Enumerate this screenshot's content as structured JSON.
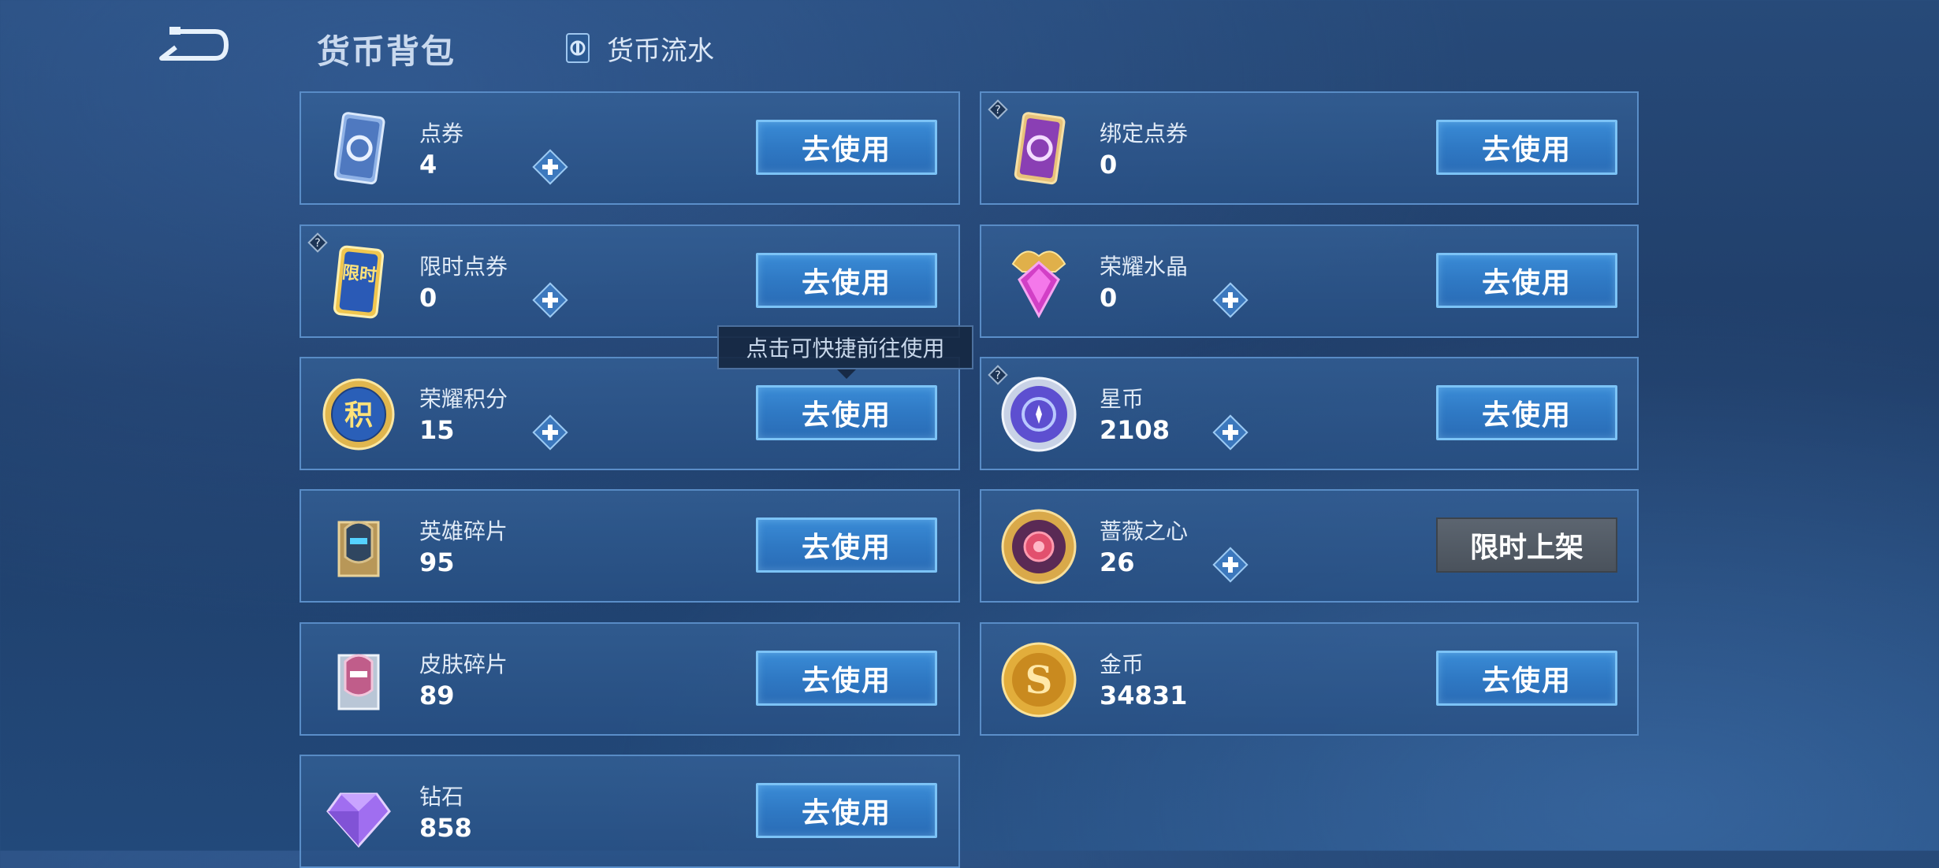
{
  "header": {
    "title": "货币背包",
    "flow_tab": "货币流水"
  },
  "tooltip": "点击可快捷前往使用",
  "currencies": [
    {
      "name": "点券",
      "value": "4",
      "button": "去使用",
      "icon": "ticket-icon"
    },
    {
      "name": "绑定点券",
      "value": "0",
      "button": "去使用",
      "icon": "bound-ticket-icon"
    },
    {
      "name": "限时点券",
      "value": "0",
      "button": "去使用",
      "icon": "limited-ticket-icon",
      "badge": "限时"
    },
    {
      "name": "荣耀水晶",
      "value": "0",
      "button": "去使用",
      "icon": "glory-crystal-icon"
    },
    {
      "name": "荣耀积分",
      "value": "15",
      "button": "去使用",
      "icon": "glory-points-icon",
      "badge": "积"
    },
    {
      "name": "星币",
      "value": "2108",
      "button": "去使用",
      "icon": "star-coin-icon"
    },
    {
      "name": "英雄碎片",
      "value": "95",
      "button": "去使用",
      "icon": "hero-fragment-icon"
    },
    {
      "name": "蔷薇之心",
      "value": "26",
      "button": "限时上架",
      "icon": "rose-heart-icon"
    },
    {
      "name": "皮肤碎片",
      "value": "89",
      "button": "去使用",
      "icon": "skin-fragment-icon"
    },
    {
      "name": "金币",
      "value": "34831",
      "button": "去使用",
      "icon": "gold-coin-icon",
      "badge": "S"
    },
    {
      "name": "钻石",
      "value": "858",
      "button": "去使用",
      "icon": "diamond-icon"
    }
  ],
  "colors": {
    "background": "#22497a",
    "card_border": "#69a0dc",
    "button_blue": "#2f79c4",
    "button_border": "#7cc3f6",
    "limited_button": "#4a525c"
  }
}
